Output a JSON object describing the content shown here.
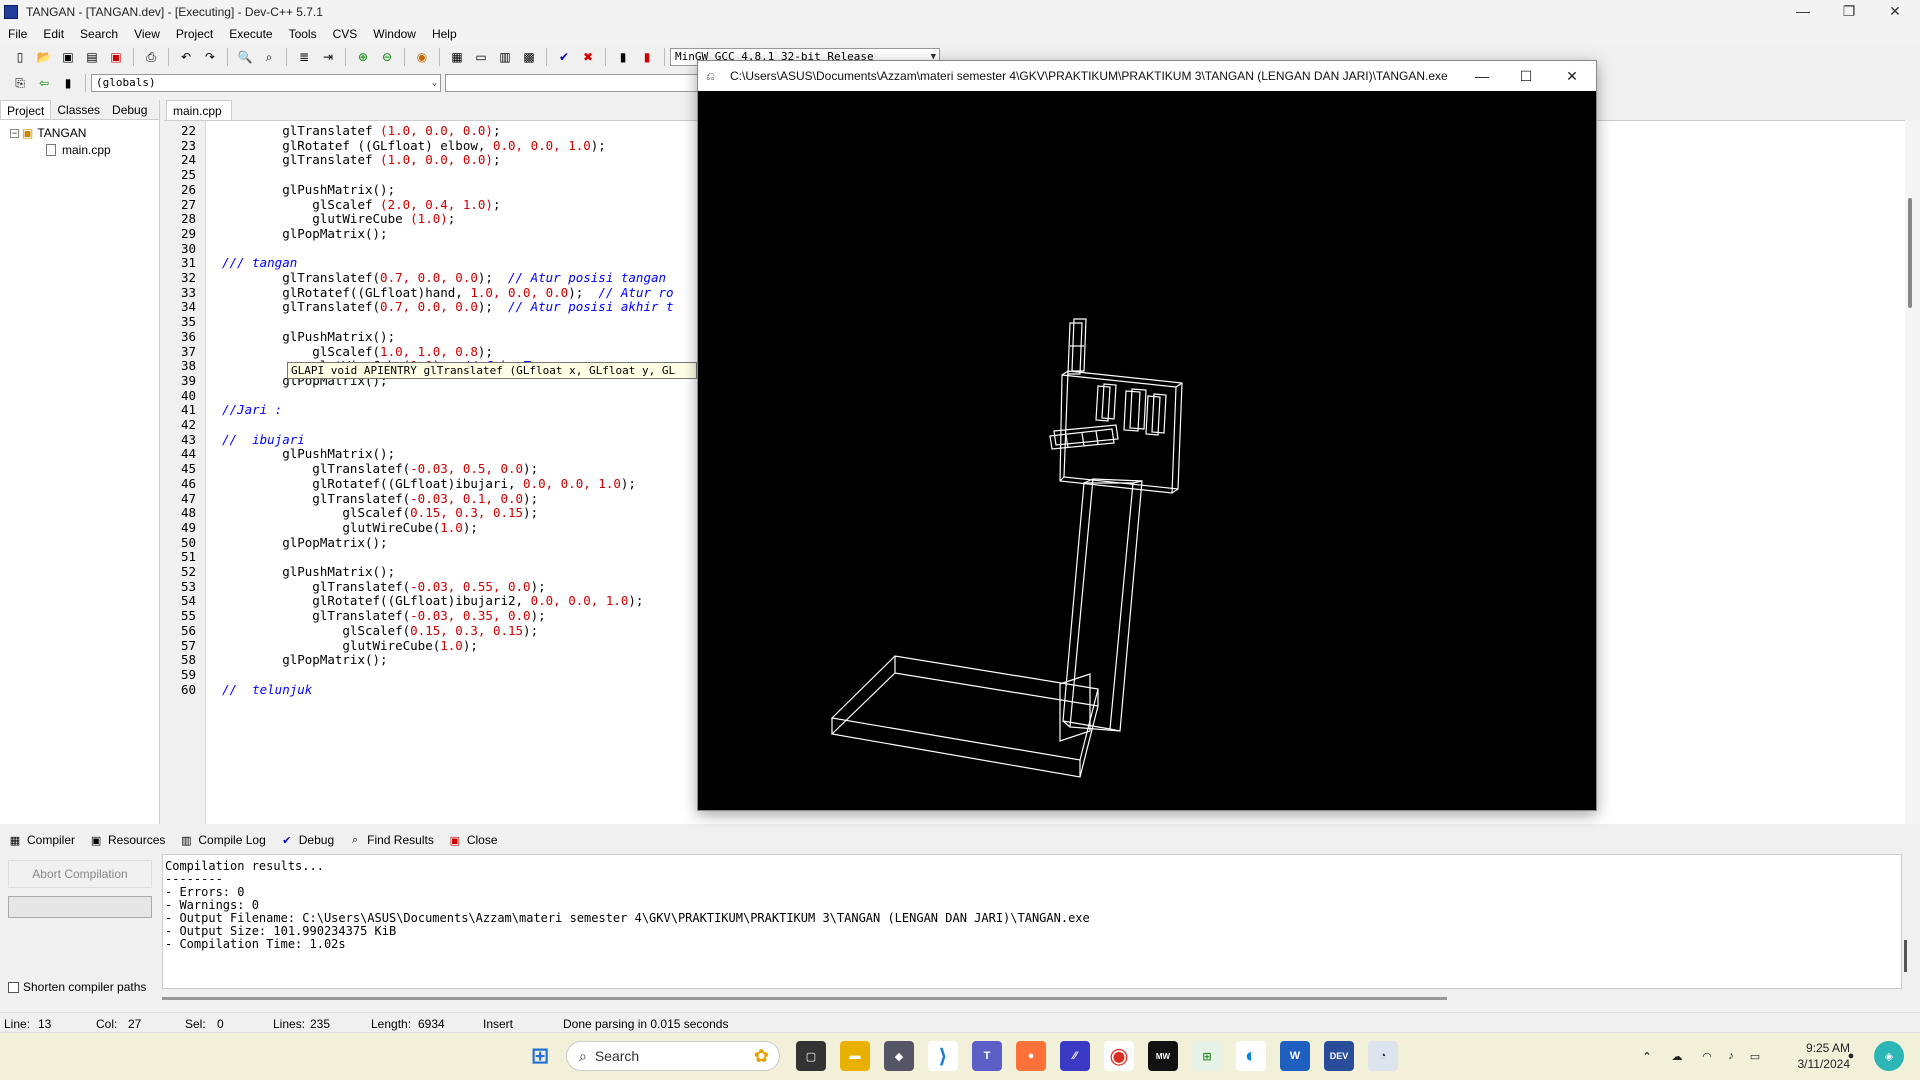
{
  "window": {
    "title": "TANGAN - [TANGAN.dev] - [Executing] - Dev-C++ 5.7.1"
  },
  "menu": [
    "File",
    "Edit",
    "Search",
    "View",
    "Project",
    "Execute",
    "Tools",
    "CVS",
    "Window",
    "Help"
  ],
  "toolbar": {
    "compiler_select": "MinGW GCC 4.8.1 32-bit Release",
    "scope_select": "(globals)"
  },
  "left_panel": {
    "tabs": [
      "Project",
      "Classes",
      "Debug"
    ],
    "project_name": "TANGAN",
    "file": "main.cpp"
  },
  "editor": {
    "tab": "main.cpp",
    "tooltip": "GLAPI void APIENTRY glTranslatef (GLfloat x, GLfloat y, GL",
    "lines": [
      {
        "n": "22",
        "html": "        glTranslatef <span class='num'>(1.0, 0.0, 0.0)</span>;"
      },
      {
        "n": "23",
        "html": "        glRotatef ((GLfloat) elbow, <span class='num'>0.0, 0.0, 1.0</span>);"
      },
      {
        "n": "24",
        "html": "        glTranslatef <span class='num'>(1.0, 0.0, 0.0)</span>;"
      },
      {
        "n": "25",
        "html": ""
      },
      {
        "n": "26",
        "html": "        glPushMatrix();"
      },
      {
        "n": "27",
        "html": "            glScalef <span class='num'>(2.0, 0.4, 1.0)</span>;"
      },
      {
        "n": "28",
        "html": "            glutWireCube <span class='num'>(1.0)</span>;"
      },
      {
        "n": "29",
        "html": "        glPopMatrix();"
      },
      {
        "n": "30",
        "html": ""
      },
      {
        "n": "31",
        "html": "<span class='cm'>/// tangan</span>"
      },
      {
        "n": "32",
        "html": "        glTranslatef(<span class='num'>0.7, 0.0, 0.0</span>);  <span class='cm'>// Atur posisi tangan</span>"
      },
      {
        "n": "33",
        "html": "        glRotatef((GLfloat)hand, <span class='num'>1.0, 0.0, 0.0</span>);  <span class='cm'>// Atur ro</span>"
      },
      {
        "n": "34",
        "html": "        glTranslatef(<span class='num'>0.7, 0.0, 0.0</span>);  <span class='cm'>// Atur posisi akhir t</span>"
      },
      {
        "n": "35",
        "html": ""
      },
      {
        "n": "36",
        "html": "        glPushMatrix();"
      },
      {
        "n": "37",
        "html": "            glScalef(<span class='num'>1.0, 1.0, 0.8</span>);"
      },
      {
        "n": "38",
        "html": "            glutWireCube(<span class='num'>1.0</span>);  <span class='cm'>// Cube Tangan</span>"
      },
      {
        "n": "39",
        "html": "        glPopMatrix();"
      },
      {
        "n": "40",
        "html": ""
      },
      {
        "n": "41",
        "html": "<span class='cm'>//Jari :</span>"
      },
      {
        "n": "42",
        "html": ""
      },
      {
        "n": "43",
        "html": "<span class='cm'>//  ibujari</span>"
      },
      {
        "n": "44",
        "html": "        glPushMatrix();"
      },
      {
        "n": "45",
        "html": "            glTranslatef(<span class='num'>-0.03, 0.5, 0.0</span>);"
      },
      {
        "n": "46",
        "html": "            glRotatef((GLfloat)ibujari, <span class='num'>0.0, 0.0, 1.0</span>);"
      },
      {
        "n": "47",
        "html": "            glTranslatef(<span class='num'>-0.03, 0.1, 0.0</span>);"
      },
      {
        "n": "48",
        "html": "                glScalef(<span class='num'>0.15, 0.3, 0.15</span>);"
      },
      {
        "n": "49",
        "html": "                glutWireCube(<span class='num'>1.0</span>);"
      },
      {
        "n": "50",
        "html": "        glPopMatrix();"
      },
      {
        "n": "51",
        "html": ""
      },
      {
        "n": "52",
        "html": "        glPushMatrix();"
      },
      {
        "n": "53",
        "html": "            glTranslatef(<span class='num'>-0.03, 0.55, 0.0</span>);"
      },
      {
        "n": "54",
        "html": "            glRotatef((GLfloat)ibujari2, <span class='num'>0.0, 0.0, 1.0</span>);"
      },
      {
        "n": "55",
        "html": "            glTranslatef(<span class='num'>-0.03, 0.35, 0.0</span>);"
      },
      {
        "n": "56",
        "html": "                glScalef(<span class='num'>0.15, 0.3, 0.15</span>);"
      },
      {
        "n": "57",
        "html": "                glutWireCube(<span class='num'>1.0</span>);"
      },
      {
        "n": "58",
        "html": "        glPopMatrix();"
      },
      {
        "n": "59",
        "html": ""
      },
      {
        "n": "60",
        "html": "<span class='cm'>//  telunjuk</span>"
      }
    ]
  },
  "bottom_tabs": [
    "Compiler",
    "Resources",
    "Compile Log",
    "Debug",
    "Find Results",
    "Close"
  ],
  "compile": {
    "abort_label": "Abort Compilation",
    "shorten_label": "Shorten compiler paths",
    "log": [
      "Compilation results...",
      "--------",
      "- Errors: 0",
      "- Warnings: 0",
      "- Output Filename: C:\\Users\\ASUS\\Documents\\Azzam\\materi semester 4\\GKV\\PRAKTIKUM\\PRAKTIKUM 3\\TANGAN (LENGAN DAN JARI)\\TANGAN.exe",
      "- Output Size: 101.990234375 KiB",
      "- Compilation Time: 1.02s"
    ]
  },
  "status": {
    "line_label": "Line:",
    "line": "13",
    "col_label": "Col:",
    "col": "27",
    "sel_label": "Sel:",
    "sel": "0",
    "lines_label": "Lines:",
    "lines": "235",
    "length_label": "Length:",
    "length": "6934",
    "mode": "Insert",
    "message": "Done parsing in 0.015 seconds"
  },
  "gl_window": {
    "title": "C:\\Users\\ASUS\\Documents\\Azzam\\materi semester 4\\GKV\\PRAKTIKUM\\PRAKTIKUM 3\\TANGAN (LENGAN DAN JARI)\\TANGAN.exe"
  },
  "taskbar": {
    "search_placeholder": "Search",
    "time": "9:25 AM",
    "date": "3/11/2024"
  }
}
